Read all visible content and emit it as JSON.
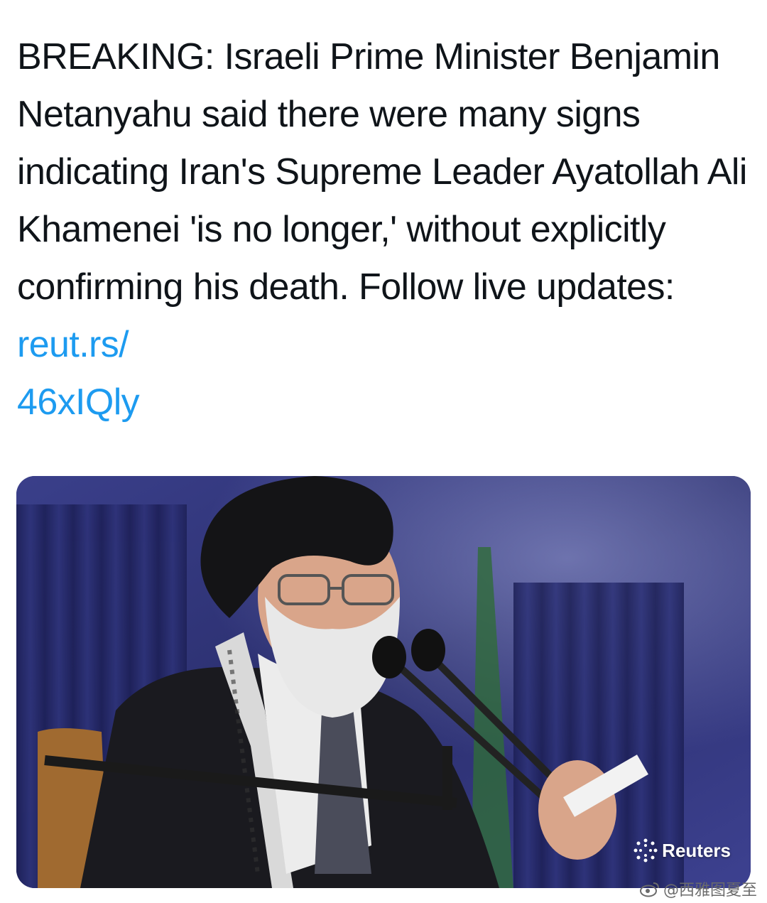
{
  "tweet": {
    "text": "BREAKING: Israeli Prime Minister Benjamin Netanyahu said there were many signs indicating Iran's Supreme Leader Ayatollah Ali Khamenei 'is no longer,' without explicitly confirming his death. Follow live updates: ",
    "link_text": "reut.rs/\n46xIQly"
  },
  "media": {
    "credit": "Reuters",
    "credit_icon": "reuters-dots-icon"
  },
  "watermark": {
    "text": "@西雅图夏至",
    "icon": "weibo-icon"
  },
  "colors": {
    "text": "#0f1419",
    "link": "#1d9bf0",
    "background": "#ffffff"
  }
}
